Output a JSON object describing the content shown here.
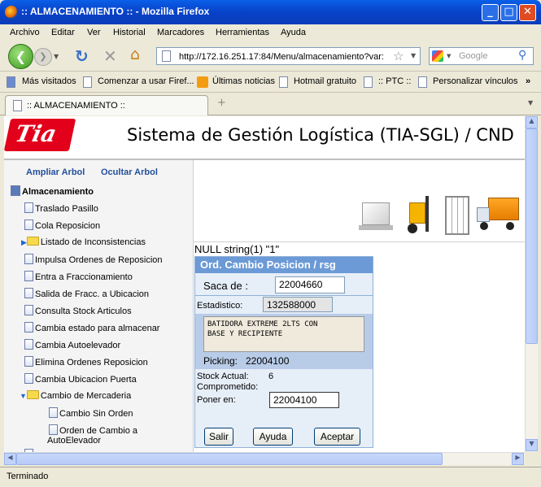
{
  "window": {
    "title": ":: ALMACENAMIENTO :: - Mozilla Firefox"
  },
  "menu": [
    "Archivo",
    "Editar",
    "Ver",
    "Historial",
    "Marcadores",
    "Herramientas",
    "Ayuda"
  ],
  "nav": {
    "url": "http://172.16.251.17:84/Menu/almacenamiento?var:",
    "search_placeholder": "Google"
  },
  "bookmarks": [
    "Más visitados",
    "Comenzar a usar Firef...",
    "Últimas noticias",
    "Hotmail gratuito",
    ":: PTC ::",
    "Personalizar vínculos"
  ],
  "tab": {
    "label": ":: ALMACENAMIENTO ::"
  },
  "header": {
    "logo": "Tia",
    "title": "Sistema de Gestión Logística (TIA-SGL) / CND"
  },
  "tree": {
    "expand_label": "Ampliar Arbol",
    "hide_label": "Ocultar Arbol",
    "root": "Almacenamiento",
    "items": [
      "Traslado Pasillo",
      "Cola Reposicion",
      "Listado de Inconsistencias",
      "Impulsa Ordenes de Reposicion",
      "Entra a Fraccionamiento",
      "Salida de Fracc. a Ubicacion",
      "Consulta Stock Articulos",
      "Cambia estado para almacenar",
      "Cambia Autoelevador",
      "Elimina Ordenes Reposicion",
      "Cambia Ubicacion Puerta",
      "Cambio de Mercaderia"
    ],
    "sub_items": [
      "Cambio Sin Orden",
      "Orden de Cambio a",
      "AutoElevador"
    ]
  },
  "debug_text": "NULL string(1) \"1\"",
  "form": {
    "title": "Ord. Cambio Posicion / rsg",
    "saca_label": "Saca de :",
    "saca_value": "22004660",
    "estadistico_label": "Estadistico:",
    "estadistico_value": "132588000",
    "description_line1": "BATIDORA EXTREME 2LTS CON",
    "description_line2": "BASE Y RECIPIENTE",
    "picking_label": "Picking:",
    "picking_value": "22004100",
    "stock_label": "Stock Actual:",
    "stock_value": "6",
    "comprometido_label": "Comprometido:",
    "poner_label": "Poner en:",
    "poner_value": "22004100",
    "btn_salir": "Salir",
    "btn_ayuda": "Ayuda",
    "btn_aceptar": "Aceptar"
  },
  "status": "Terminado"
}
